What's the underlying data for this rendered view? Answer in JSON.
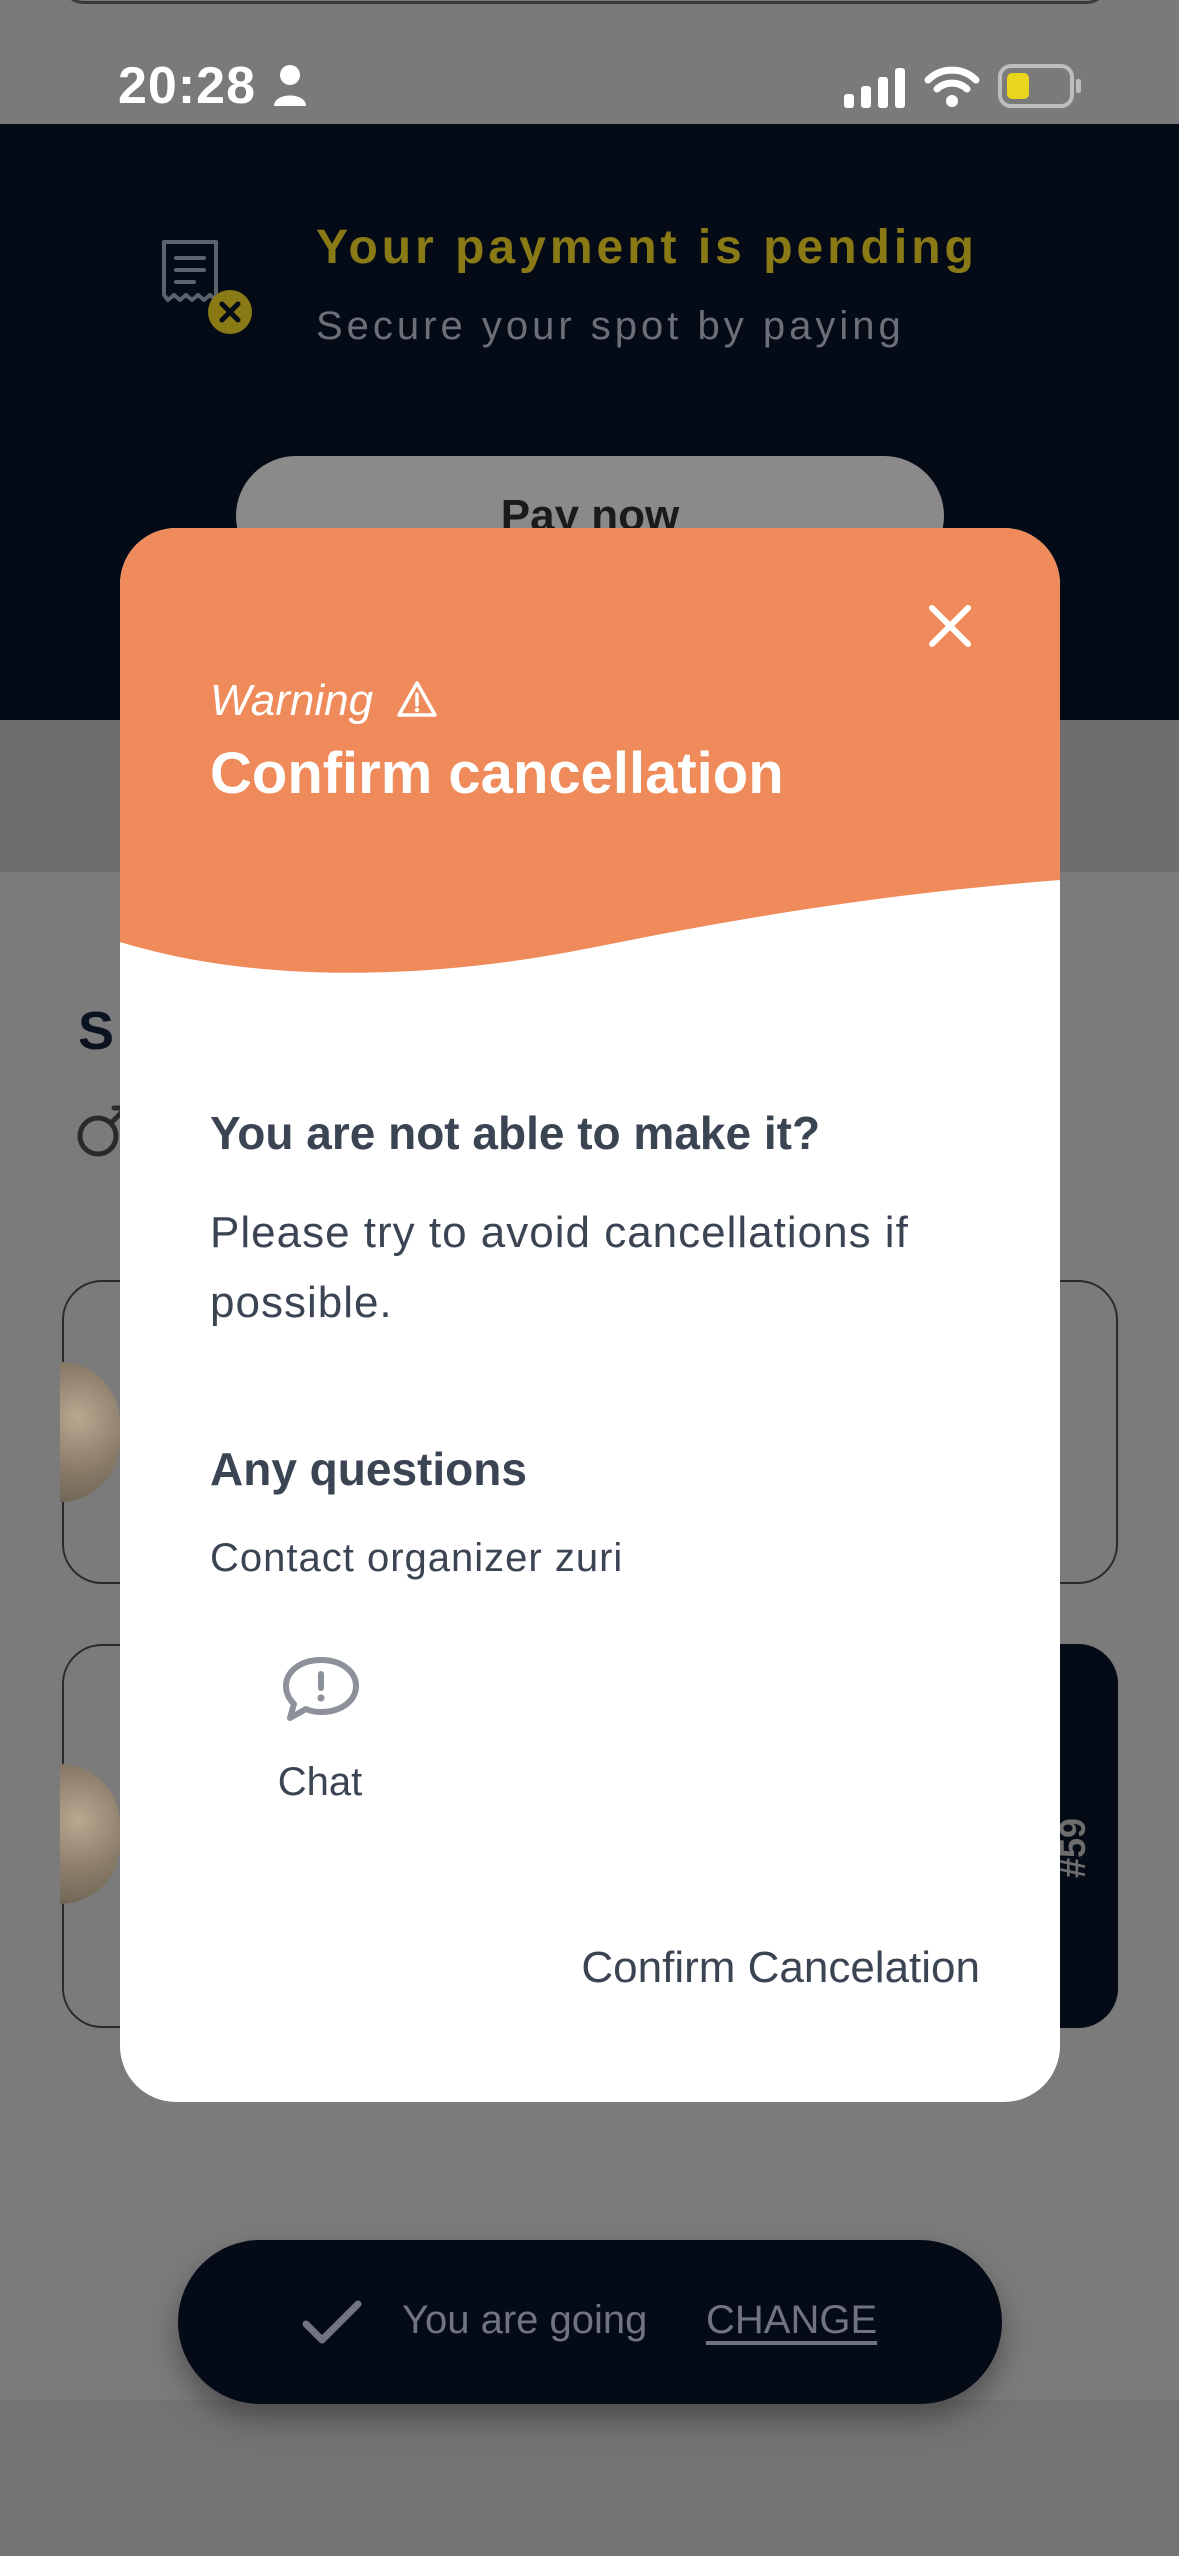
{
  "status_bar": {
    "time": "20:28"
  },
  "banner": {
    "title": "Your payment is pending",
    "subtitle": "Secure your spot by paying",
    "pay_button": "Pay now"
  },
  "background": {
    "section_heading_peek": "S",
    "card_number": "#59"
  },
  "going_bar": {
    "status": "You are going",
    "change": "CHANGE"
  },
  "modal": {
    "warning_label": "Warning",
    "title": "Confirm cancellation",
    "question_heading": "You are not able to make it?",
    "question_body": "Please try to avoid cancellations if possible.",
    "questions_heading": "Any questions",
    "contact_text": "Contact organizer zuri",
    "chat_label": "Chat",
    "confirm_button": "Confirm Cancelation"
  },
  "colors": {
    "modal_header": "#ef8a5a",
    "banner_bg": "#050b16",
    "pending_title": "#8a7a16",
    "text_dark": "#3b4453",
    "battery": "#e9d51c"
  },
  "icons": {
    "status_person": "person-icon",
    "signal": "signal-icon",
    "wifi": "wifi-icon",
    "battery": "battery-icon",
    "receipt": "receipt-icon",
    "close": "close-icon",
    "warning": "warning-triangle-icon",
    "chat": "chat-bubble-icon",
    "check": "check-icon",
    "gender": "male-icon"
  }
}
